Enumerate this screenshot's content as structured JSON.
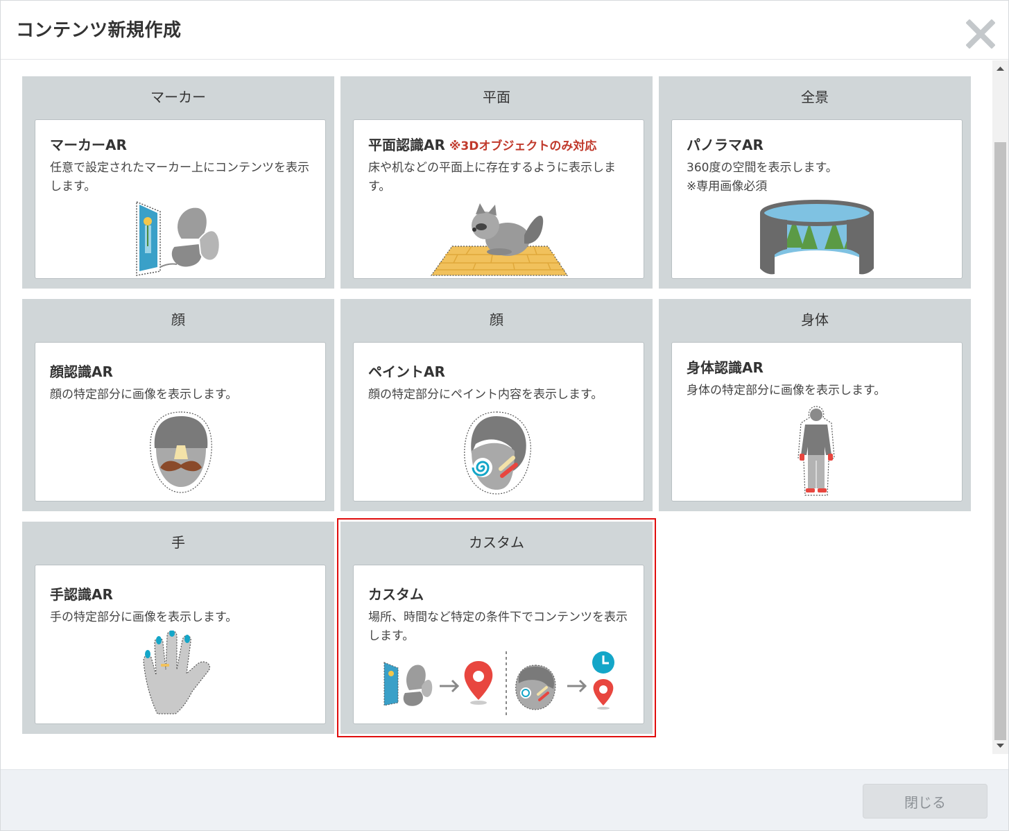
{
  "dialog": {
    "title": "コンテンツ新規作成",
    "close_icon": "close-icon",
    "footer_close_label": "閉じる"
  },
  "categories": [
    {
      "title": "マーカー",
      "card_title": "マーカーAR",
      "note": "",
      "desc": "任意で設定されたマーカー上にコンテンツを表示します。",
      "icon": "marker-butterfly-icon"
    },
    {
      "title": "平面",
      "card_title": "平面認識AR",
      "note": "※3Dオブジェクトのみ対応",
      "desc": "床や机などの平面上に存在するように表示します。",
      "icon": "raccoon-on-floor-icon"
    },
    {
      "title": "全景",
      "card_title": "パノラマAR",
      "note": "",
      "desc": "360度の空間を表示します。",
      "desc2": "※専用画像必須",
      "icon": "panorama-cylinder-icon"
    },
    {
      "title": "顔",
      "card_title": "顔認識AR",
      "note": "",
      "desc": "顔の特定部分に画像を表示します。",
      "icon": "face-mustache-icon"
    },
    {
      "title": "顔",
      "card_title": "ペイントAR",
      "note": "",
      "desc": "顔の特定部分にペイント内容を表示します。",
      "icon": "face-paint-icon"
    },
    {
      "title": "身体",
      "card_title": "身体認識AR",
      "note": "",
      "desc": "身体の特定部分に画像を表示します。",
      "icon": "body-figure-icon"
    },
    {
      "title": "手",
      "card_title": "手認識AR",
      "note": "",
      "desc": "手の特定部分に画像を表示します。",
      "icon": "hand-icon"
    },
    {
      "title": "カスタム",
      "card_title": "カスタム",
      "note": "",
      "desc": "場所、時間など特定の条件下でコンテンツを表示します。",
      "icon": "custom-conditions-icon",
      "selected": true
    }
  ],
  "colors": {
    "selected_outline": "#e00d0d",
    "category_bg": "#d0d6d8",
    "note_red": "#c0392b",
    "accent_teal": "#14a6c8",
    "pin_red": "#e8463f"
  }
}
